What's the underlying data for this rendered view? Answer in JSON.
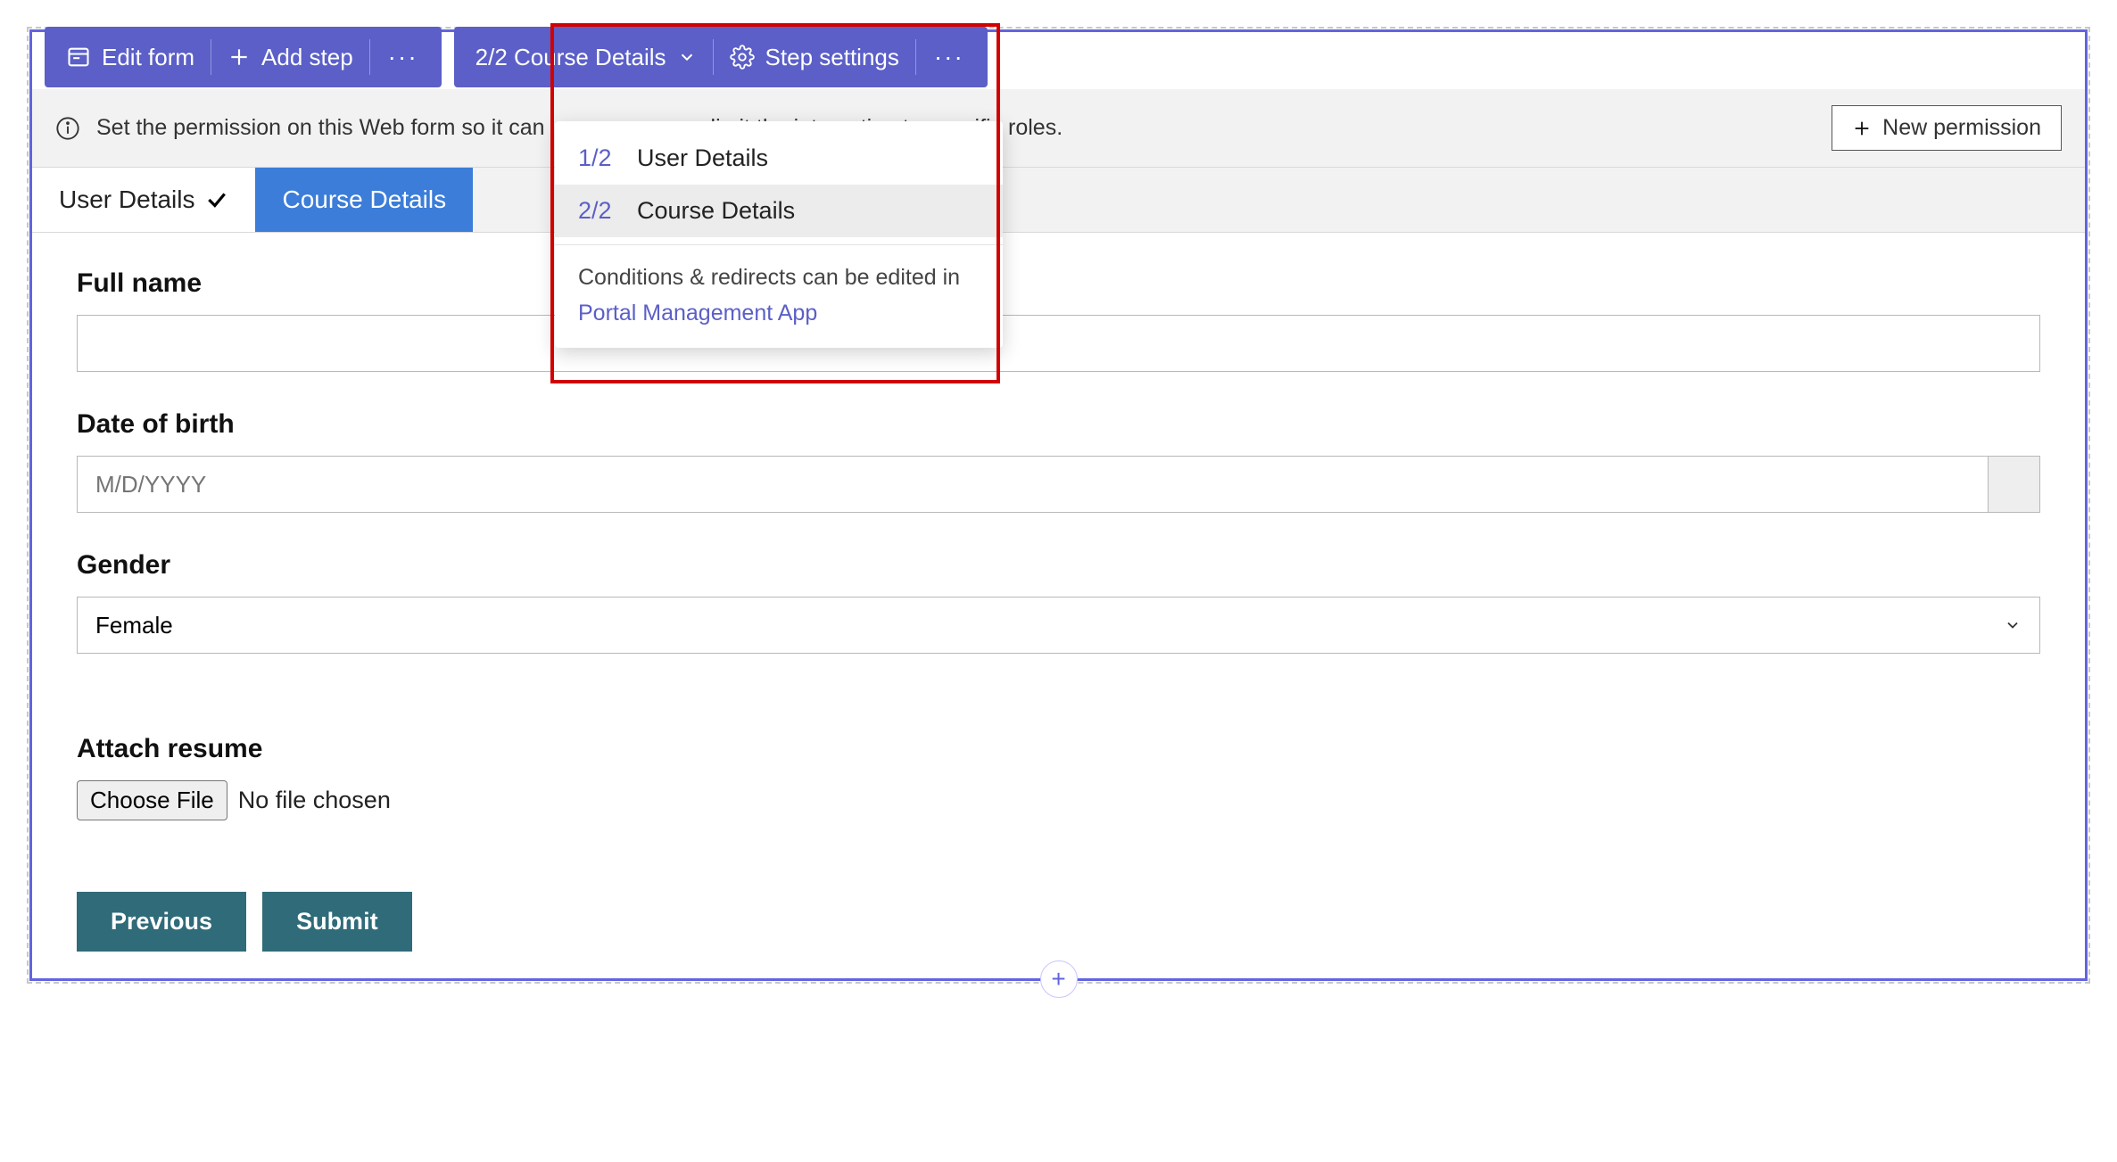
{
  "toolbar": {
    "edit_form": "Edit form",
    "add_step": "Add step",
    "step_picker": "2/2 Course Details",
    "step_settings": "Step settings"
  },
  "dropdown": {
    "items": [
      {
        "num": "1/2",
        "label": "User Details"
      },
      {
        "num": "2/2",
        "label": "Course Details"
      }
    ],
    "footer_text": "Conditions & redirects can be edited in",
    "footer_link": "Portal Management App"
  },
  "permission": {
    "message_before": "Set the permission on this Web form so it can",
    "message_after": "limit the interaction to specific roles.",
    "button": "New permission"
  },
  "tabs": [
    {
      "label": "User Details",
      "checked": true
    },
    {
      "label": "Course Details",
      "checked": false
    }
  ],
  "form": {
    "full_name": {
      "label": "Full name",
      "value": ""
    },
    "dob": {
      "label": "Date of birth",
      "placeholder": "M/D/YYYY"
    },
    "gender": {
      "label": "Gender",
      "value": "Female"
    },
    "attach": {
      "label": "Attach resume",
      "button": "Choose File",
      "status": "No file chosen"
    }
  },
  "actions": {
    "previous": "Previous",
    "submit": "Submit"
  }
}
